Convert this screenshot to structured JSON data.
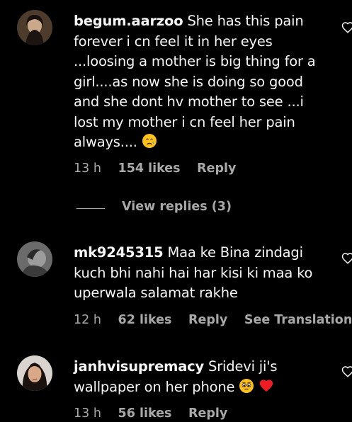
{
  "comments": [
    {
      "username": "begum.aarzoo",
      "text": "She has this pain forever i cn feel it in her eyes ...loosing a mother is big thing for a girl....as now she is doing so good and she dont hv mother to see ...i lost my mother i cn feel her pain always....",
      "emoji": "crying-face",
      "time": "13 h",
      "likes": "154 likes",
      "reply": "Reply"
    },
    {
      "username": "mk9245315",
      "text": "Maa ke Bina zindagi kuch bhi nahi hai har kisi ki maa ko uperwala salamat rakhe",
      "time": "12 h",
      "likes": "62 likes",
      "reply": "Reply",
      "translation": "See Translation"
    },
    {
      "username": "janhvisupremacy",
      "text": "Sridevi ji's wallpaper on her phone",
      "emojis": [
        "pleading-face",
        "red-heart"
      ],
      "time": "13 h",
      "likes": "56 likes",
      "reply": "Reply"
    }
  ],
  "view_replies": "View replies (3)",
  "colors": {
    "background": "#000000",
    "text": "#f5f5f5",
    "secondary": "#a8a8a8",
    "heart": "#ed1c24"
  }
}
